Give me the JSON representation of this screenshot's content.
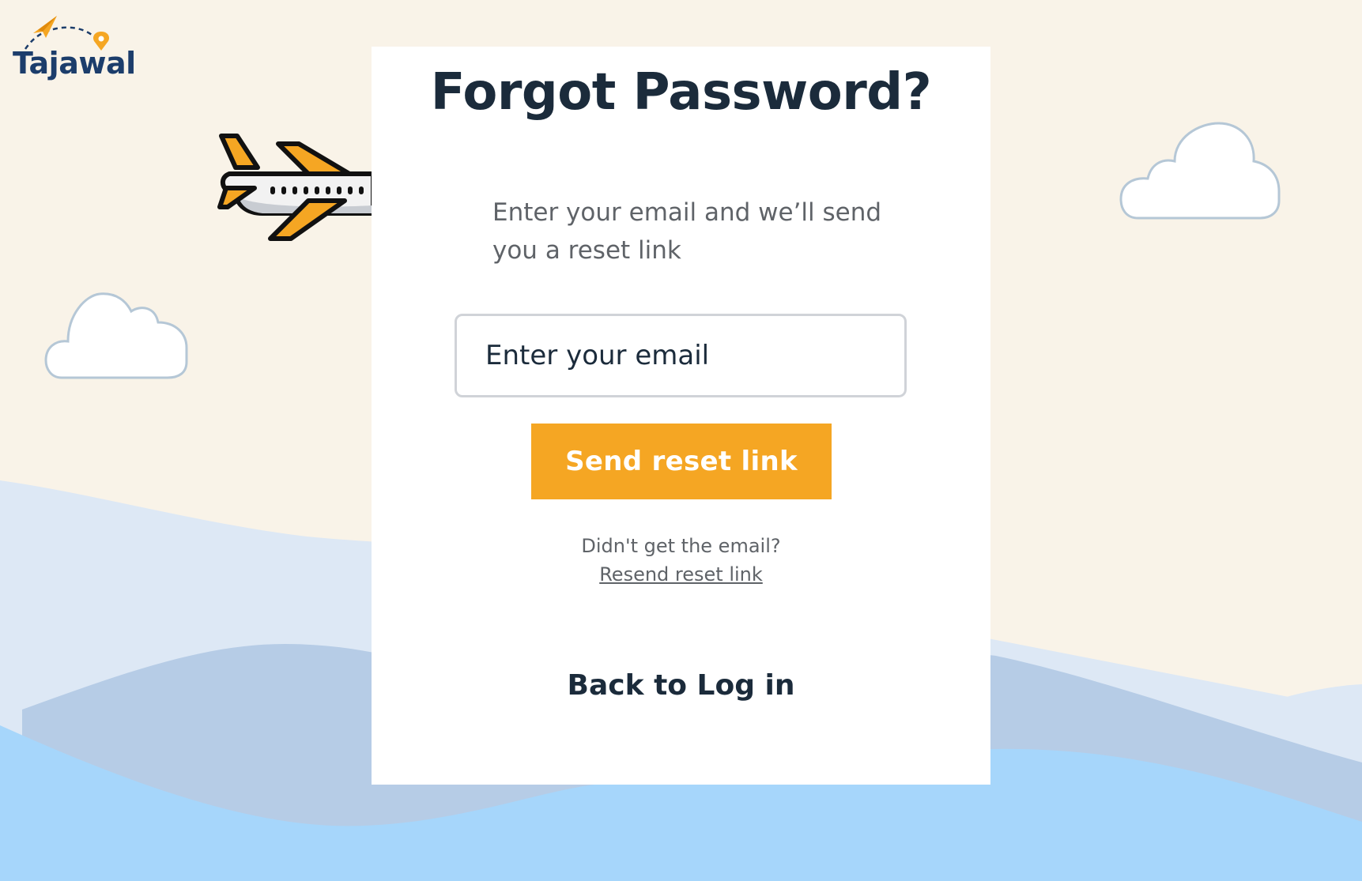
{
  "brand": {
    "logo_text": "Tajawal",
    "colors": {
      "navy": "#1c3d6b",
      "orange": "#f5a623"
    }
  },
  "card": {
    "title": "Forgot Password?",
    "subtitle": "Enter your email and we’ll send you a reset link",
    "email": {
      "placeholder": "Enter your email",
      "value": ""
    },
    "send_button_label": "Send reset link",
    "resend_prompt": "Didn't get the email?",
    "resend_link_label": "Resend reset link",
    "back_link_label": "Back to Log in"
  },
  "decorations": {
    "icons": [
      "paper-plane-icon",
      "location-pin-icon",
      "airplane-icon",
      "cloud-icon"
    ],
    "colors": {
      "background": "#f9f3e8",
      "wave_light": "#dde8f5",
      "wave_mid": "#b6cce6",
      "wave_front": "#a6d6fb",
      "cloud_outline": "#b5c7d6"
    }
  }
}
